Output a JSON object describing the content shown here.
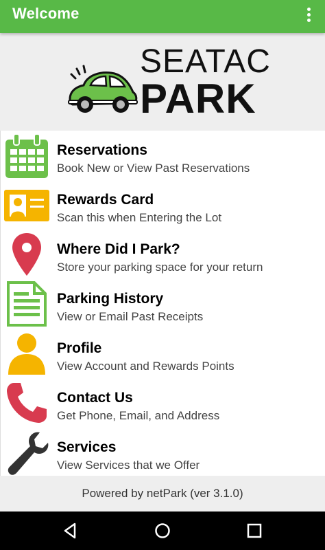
{
  "appbar": {
    "title": "Welcome",
    "overflow_icon": "overflow-menu-icon"
  },
  "logo": {
    "line1": "SEATAC",
    "line2": "PARK",
    "car_color": "#6cc04a"
  },
  "colors": {
    "accent": "#58b947",
    "calendar": "#6cc04a",
    "card": "#f5b400",
    "pin": "#d83b4f",
    "doc": "#6cc04a",
    "profile": "#f5b400",
    "phone": "#d83b4f",
    "wrench": "#333333"
  },
  "menu": {
    "items": [
      {
        "title": "Reservations",
        "subtitle": "Book New or View Past Reservations",
        "icon": "calendar-icon"
      },
      {
        "title": "Rewards Card",
        "subtitle": "Scan this when Entering the Lot",
        "icon": "id-card-icon"
      },
      {
        "title": "Where Did I Park?",
        "subtitle": "Store your parking space for your return",
        "icon": "map-pin-icon"
      },
      {
        "title": "Parking History",
        "subtitle": "View or Email Past Receipts",
        "icon": "document-icon"
      },
      {
        "title": "Profile",
        "subtitle": "View Account and Rewards Points",
        "icon": "person-icon"
      },
      {
        "title": "Contact Us",
        "subtitle": "Get Phone, Email, and Address",
        "icon": "phone-icon"
      },
      {
        "title": "Services",
        "subtitle": "View Services that we Offer",
        "icon": "wrench-icon"
      }
    ]
  },
  "footer": {
    "text": "Powered by netPark (ver 3.1.0)"
  },
  "navbar": {
    "back_icon": "back-icon",
    "home_icon": "home-icon",
    "recents_icon": "recents-icon"
  }
}
